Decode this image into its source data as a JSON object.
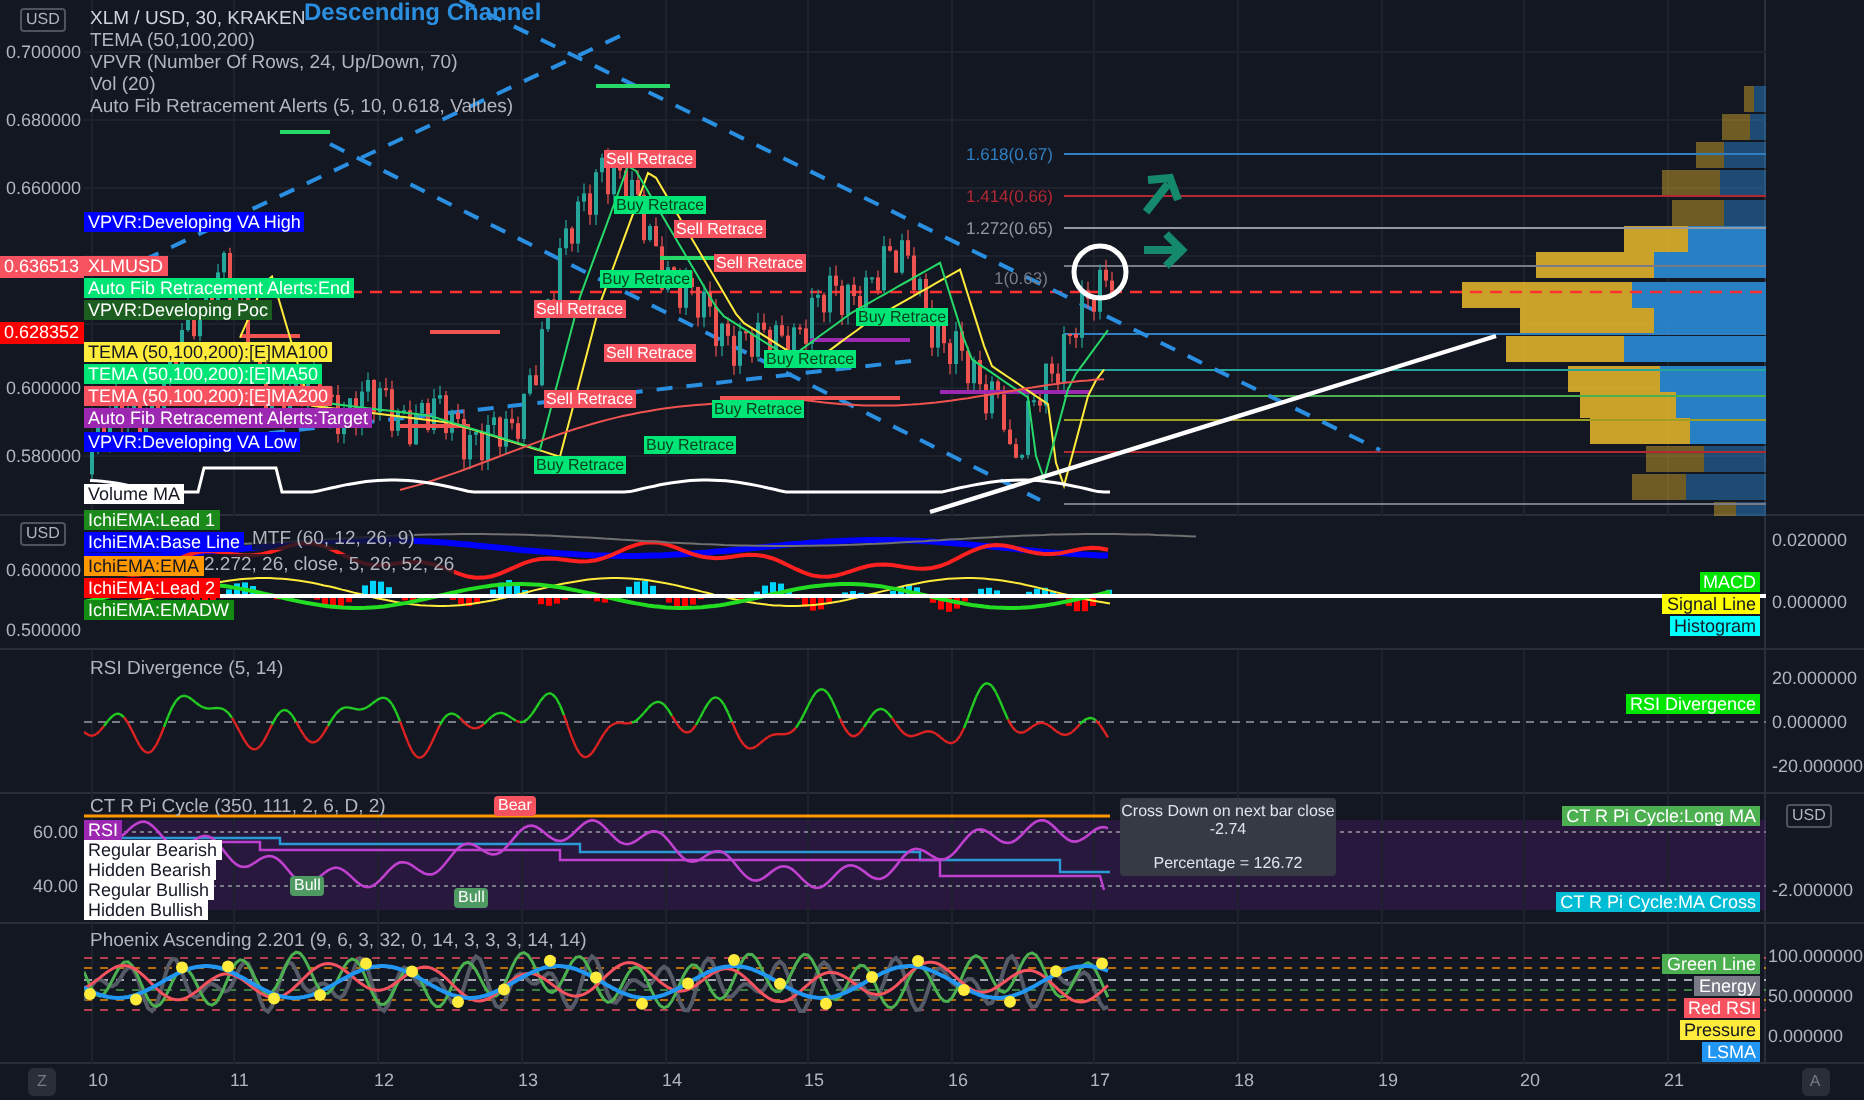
{
  "chart_title": "Descending Channel",
  "main_pane": {
    "currency": "USD",
    "price_ticks": [
      "0.700000",
      "0.680000",
      "0.660000",
      "0.600000",
      "0.580000"
    ],
    "price_badges": [
      {
        "text": "0.636513",
        "color": "#f7525f"
      },
      {
        "text": "0.628352",
        "color": "#ff0000"
      }
    ],
    "legend": [
      "XLM / USD, 30, KRAKEN",
      "TEMA (50,100,200)",
      "VPVR (Number Of Rows, 24, Up/Down, 70)",
      "Vol (20)",
      "Auto Fib Retracement Alerts (5, 10, 0.618, Values)"
    ],
    "series_labels": [
      {
        "text": "VPVR:Developing VA High",
        "color": "#0000ff"
      },
      {
        "text": "XLMUSD",
        "color": "#f7525f"
      },
      {
        "text": "Auto Fib Retracement Alerts:End",
        "color": "#00e676"
      },
      {
        "text": "VPVR:Developing Poc",
        "color": "#1b5e20"
      },
      {
        "text": "TEMA (50,100,200):[E]MA100",
        "color": "#ffeb3b"
      },
      {
        "text": "TEMA (50,100,200):[E]MA50",
        "color": "#00e676"
      },
      {
        "text": "TEMA (50,100,200):[E]MA200",
        "color": "#f7525f"
      },
      {
        "text": "Auto Fib Retracement Alerts:Target",
        "color": "#9c27b0"
      },
      {
        "text": "VPVR:Developing VA Low",
        "color": "#0000ff"
      },
      {
        "text": "Volume MA",
        "color": "#ffffff"
      }
    ],
    "fib_levels": [
      {
        "text": "1.618(0.67)",
        "color": "#2f7fc1"
      },
      {
        "text": "1.414(0.66)",
        "color": "#b22833"
      },
      {
        "text": "1.272(0.65)",
        "color": "#9598a1"
      },
      {
        "text": "1(0.63)",
        "color": "#787b86"
      }
    ],
    "signals": [
      {
        "text": "Sell Retrace",
        "kind": "sell"
      },
      {
        "text": "Buy Retrace",
        "kind": "buy"
      },
      {
        "text": "Sell Retrace",
        "kind": "sell"
      },
      {
        "text": "Sell Retrace",
        "kind": "sell"
      },
      {
        "text": "Buy Retrace",
        "kind": "buy"
      },
      {
        "text": "Sell Retrace",
        "kind": "sell"
      },
      {
        "text": "Buy Retrace",
        "kind": "buy"
      },
      {
        "text": "Sell Retrace",
        "kind": "sell"
      },
      {
        "text": "Buy Retrace",
        "kind": "buy"
      },
      {
        "text": "Sell Retrace",
        "kind": "sell"
      },
      {
        "text": "Buy Retrace",
        "kind": "buy"
      },
      {
        "text": "Buy Retrace",
        "kind": "buy"
      },
      {
        "text": "Buy Retrace",
        "kind": "buy"
      }
    ]
  },
  "macd_pane": {
    "currency": "USD",
    "left_ticks": [
      "0.600000",
      "0.500000"
    ],
    "right_ticks": [
      "0.020000",
      "0.000000"
    ],
    "legend": [
      "MTF (60, 12, 26, 9)",
      "2.272, 26, close, 5, 26, 52, 26"
    ],
    "left_labels": [
      {
        "text": "IchiEMA:Lead 1",
        "color": "#1b8a1b"
      },
      {
        "text": "IchiEMA:Base Line",
        "color": "#0000ff"
      },
      {
        "text": "IchiEMA:EMA",
        "color": "#ff9800"
      },
      {
        "text": "IchiEMA:Lead 2",
        "color": "#ff0000"
      },
      {
        "text": "IchiEMA:EMADW",
        "color": "#138a13"
      }
    ],
    "right_labels": [
      {
        "text": "MACD",
        "color": "#00e600"
      },
      {
        "text": "Signal Line",
        "color": "#ffff00"
      },
      {
        "text": "Histogram",
        "color": "#00ffff"
      }
    ]
  },
  "rsi_pane": {
    "legend": "RSI Divergence (5, 14)",
    "right_ticks": [
      "20.000000",
      "0.000000",
      "-20.000000"
    ],
    "right_labels": [
      {
        "text": "RSI Divergence",
        "color": "#00e600"
      }
    ]
  },
  "pi_pane": {
    "legend": "CT R Pi Cycle (350, 111, 2, 6, D, 2)",
    "left_ticks": [
      "60.00",
      "40.00"
    ],
    "currency": "USD",
    "right_ticks": [
      "-2.000000"
    ],
    "left_labels": [
      {
        "text": "RSI",
        "color": "#9c27b0"
      },
      {
        "text": "Regular Bearish",
        "color": "#ffffff"
      },
      {
        "text": "Hidden Bearish",
        "color": "#ffffff"
      },
      {
        "text": "Regular Bullish",
        "color": "#ffffff"
      },
      {
        "text": "Hidden Bullish",
        "color": "#ffffff"
      }
    ],
    "right_labels": [
      {
        "text": "CT R Pi Cycle:Long MA",
        "color": "#4caf50"
      },
      {
        "text": "CT R Pi Cycle:MA Cross",
        "color": "#00bcd4"
      }
    ],
    "tooltip": [
      "Cross Down on next bar close",
      "-2.74",
      "Percentage = 126.72"
    ],
    "signals": [
      {
        "text": "Bear",
        "kind": "bear"
      },
      {
        "text": "Bull",
        "kind": "bull"
      },
      {
        "text": "Bull",
        "kind": "bull"
      }
    ]
  },
  "phoenix_pane": {
    "legend": "Phoenix Ascending 2.201 (9, 6, 3, 32, 0, 14, 3, 3, 3, 14, 14)",
    "right_ticks": [
      "100.000000",
      "50.000000",
      "0.000000"
    ],
    "right_labels": [
      {
        "text": "Green Line",
        "color": "#4caf50"
      },
      {
        "text": "Energy",
        "color": "#787b86"
      },
      {
        "text": "Red RSI",
        "color": "#f7525f"
      },
      {
        "text": "Pressure",
        "color": "#ffeb3b"
      },
      {
        "text": "LSMA",
        "color": "#2196f3"
      }
    ]
  },
  "time_axis": {
    "ticks": [
      "10",
      "11",
      "12",
      "13",
      "14",
      "15",
      "16",
      "17",
      "18",
      "19",
      "20",
      "21"
    ],
    "left_button": "Z",
    "right_button": "A"
  }
}
